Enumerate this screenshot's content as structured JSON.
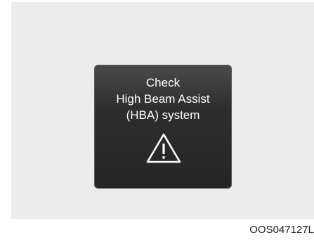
{
  "display": {
    "lines": [
      "Check",
      "High Beam Assist",
      "(HBA) system"
    ],
    "icon": "warning-triangle-icon"
  },
  "figure_code": "OOS047127L",
  "colors": {
    "background_panel": "#ececec",
    "display_bg": "#2e2e2e",
    "display_text": "#ffffff"
  }
}
